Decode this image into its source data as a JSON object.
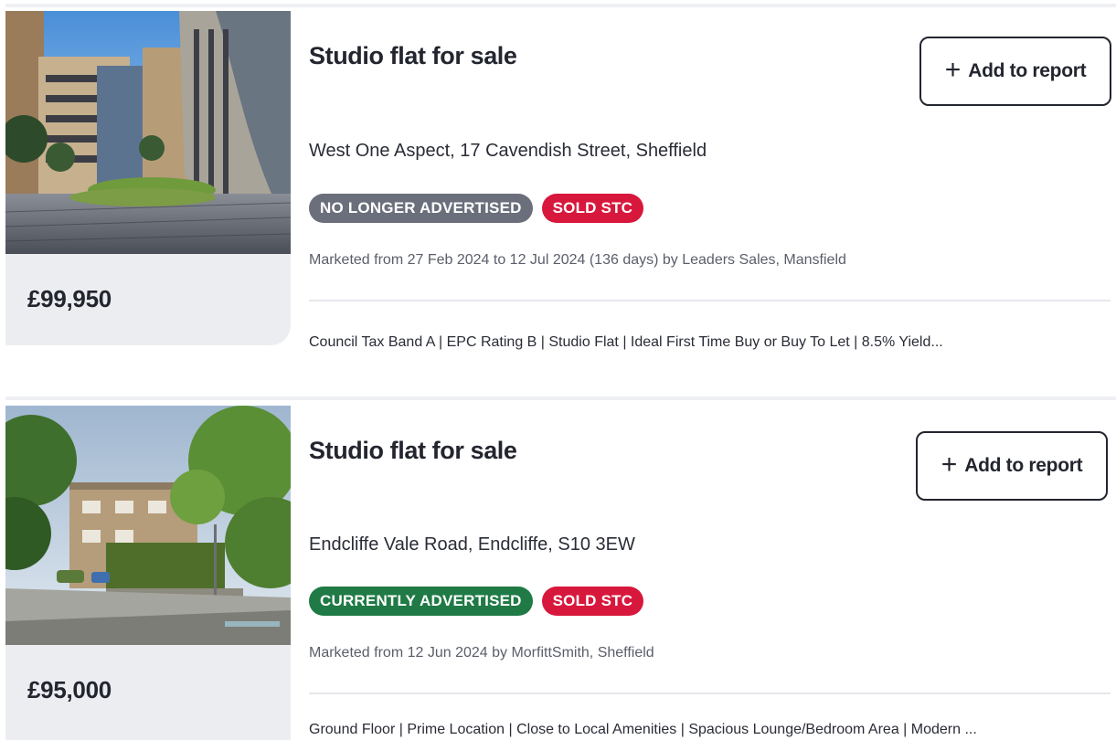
{
  "listings": [
    {
      "title": "Studio flat for sale",
      "add_to_report_label": "Add to report",
      "add_icon": "plus-icon",
      "address": "West One Aspect, 17 Cavendish Street, Sheffield",
      "badges": [
        {
          "label": "NO LONGER ADVERTISED",
          "color": "#6b6f7c"
        },
        {
          "label": "SOLD STC",
          "color": "#d8173c"
        }
      ],
      "marketed": "Marketed from 27 Feb 2024 to 12 Jul 2024 (136 days) by Leaders Sales, Mansfield",
      "features": "Council Tax Band A | EPC Rating B | Studio Flat | Ideal First Time Buy or Buy To Let | 8.5% Yield...",
      "price": "£99,950",
      "photo": "apartment-courtyard-photo"
    },
    {
      "title": "Studio flat for sale",
      "add_to_report_label": "Add to report",
      "add_icon": "plus-icon",
      "address": "Endcliffe Vale Road, Endcliffe, S10 3EW",
      "badges": [
        {
          "label": "CURRENTLY ADVERTISED",
          "color": "#1f7a45"
        },
        {
          "label": "SOLD STC",
          "color": "#d8173c"
        }
      ],
      "marketed": "Marketed from 12 Jun 2024 by MorfittSmith, Sheffield",
      "features": "Ground Floor | Prime Location | Close to Local Amenities | Spacious Lounge/Bedroom Area | Modern ...",
      "price": "£95,000",
      "photo": "street-with-trees-photo"
    }
  ]
}
